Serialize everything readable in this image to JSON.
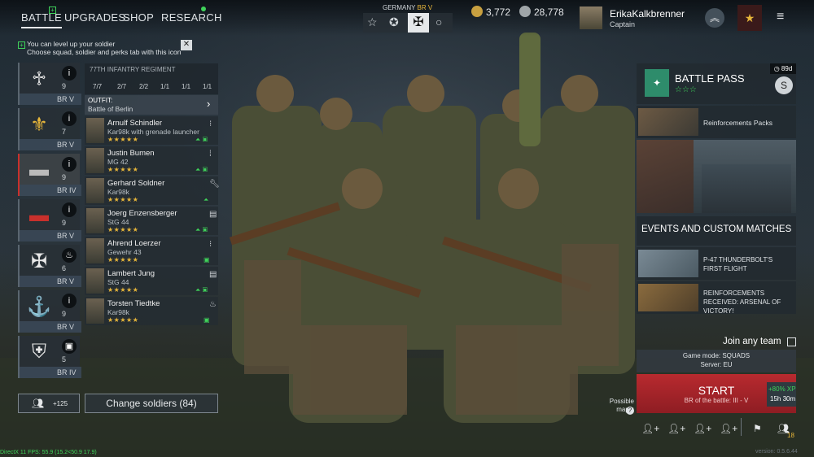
{
  "nav": {
    "tabs": [
      "BATTLE",
      "UPGRADES",
      "SHOP",
      "RESEARCH"
    ]
  },
  "nation": {
    "label": "GERMANY",
    "br": "BR V"
  },
  "currency": {
    "silver": "3,772",
    "gold": "28,778"
  },
  "profile": {
    "name": "ErikaKalkbrenner",
    "rank": "Captain"
  },
  "notice": {
    "line1": "You can level up your soldier",
    "line2": "Choose squad, soldier and perks tab with this icon"
  },
  "regiment": {
    "name": "77TH INFANTRY REGIMENT",
    "stats": [
      "7/7",
      "2/7",
      "2/2",
      "1/1",
      "1/1",
      "1/1"
    ],
    "outfit_label": "OUTFIT:",
    "outfit_value": "Battle of Berlin"
  },
  "squads": [
    {
      "icon": "♱",
      "count": "9",
      "br": "BR V"
    },
    {
      "icon": "⚜",
      "count": "7",
      "br": "BR V"
    },
    {
      "icon": "▬",
      "count": "9",
      "br": "BR IV"
    },
    {
      "icon": "▬",
      "count": "9",
      "br": "BR V"
    },
    {
      "icon": "✠",
      "count": "6",
      "br": "BR V"
    },
    {
      "icon": "⚓",
      "count": "9",
      "br": "BR V"
    },
    {
      "icon": "⛨",
      "count": "5",
      "br": "BR IV"
    }
  ],
  "soldiers": [
    {
      "name": "Arnulf Schindler",
      "weapon": "Kar98k with grenade launcher",
      "stars": "★★★★★"
    },
    {
      "name": "Justin Bumen",
      "weapon": "MG 42",
      "stars": "★★★★★"
    },
    {
      "name": "Gerhard Soldner",
      "weapon": "Kar98k",
      "stars": "★★★★★"
    },
    {
      "name": "Joerg Enzensberger",
      "weapon": "StG 44",
      "stars": "★★★★★"
    },
    {
      "name": "Ahrend Loerzer",
      "weapon": "Gewehr 43",
      "stars": "★★★★★"
    },
    {
      "name": "Lambert Jung",
      "weapon": "StG 44",
      "stars": "★★★★★"
    },
    {
      "name": "Torsten Tiedtke",
      "weapon": "Kar98k",
      "stars": "★★★★★"
    }
  ],
  "bottom_left": {
    "reserve": "+125",
    "change_soldiers": "Change soldiers (84)"
  },
  "battle_pass": {
    "title": "BATTLE PASS",
    "days": "89d",
    "stars": "☆☆☆",
    "reinforcements": "Reinforcements Packs"
  },
  "events": {
    "header": "EVENTS AND CUSTOM MATCHES",
    "items": [
      "P-47 THUNDERBOLT'S FIRST FLIGHT",
      "REINFORCEMENTS RECEIVED: ARSENAL OF VICTORY!"
    ]
  },
  "match": {
    "join_any": "Join any team",
    "mode": "Game mode: SQUADS",
    "server": "Server: EU",
    "start": "START",
    "br_line": "BR of the battle: III - V",
    "bonus_xp": "+80% XP",
    "bonus_time": "15h 30m",
    "possible_maps": "Possible maps:"
  },
  "footer": {
    "version": "version: 0.5.6.44",
    "debug": "DirectX 11 FPS: 55.9 (15.2<50.9 17.9)",
    "team_count": "18"
  },
  "colors": {
    "accent_green": "#3fd35a",
    "start_red": "#a8242a",
    "gold": "#e7b63a",
    "pass_teal": "#2e8c6b"
  }
}
